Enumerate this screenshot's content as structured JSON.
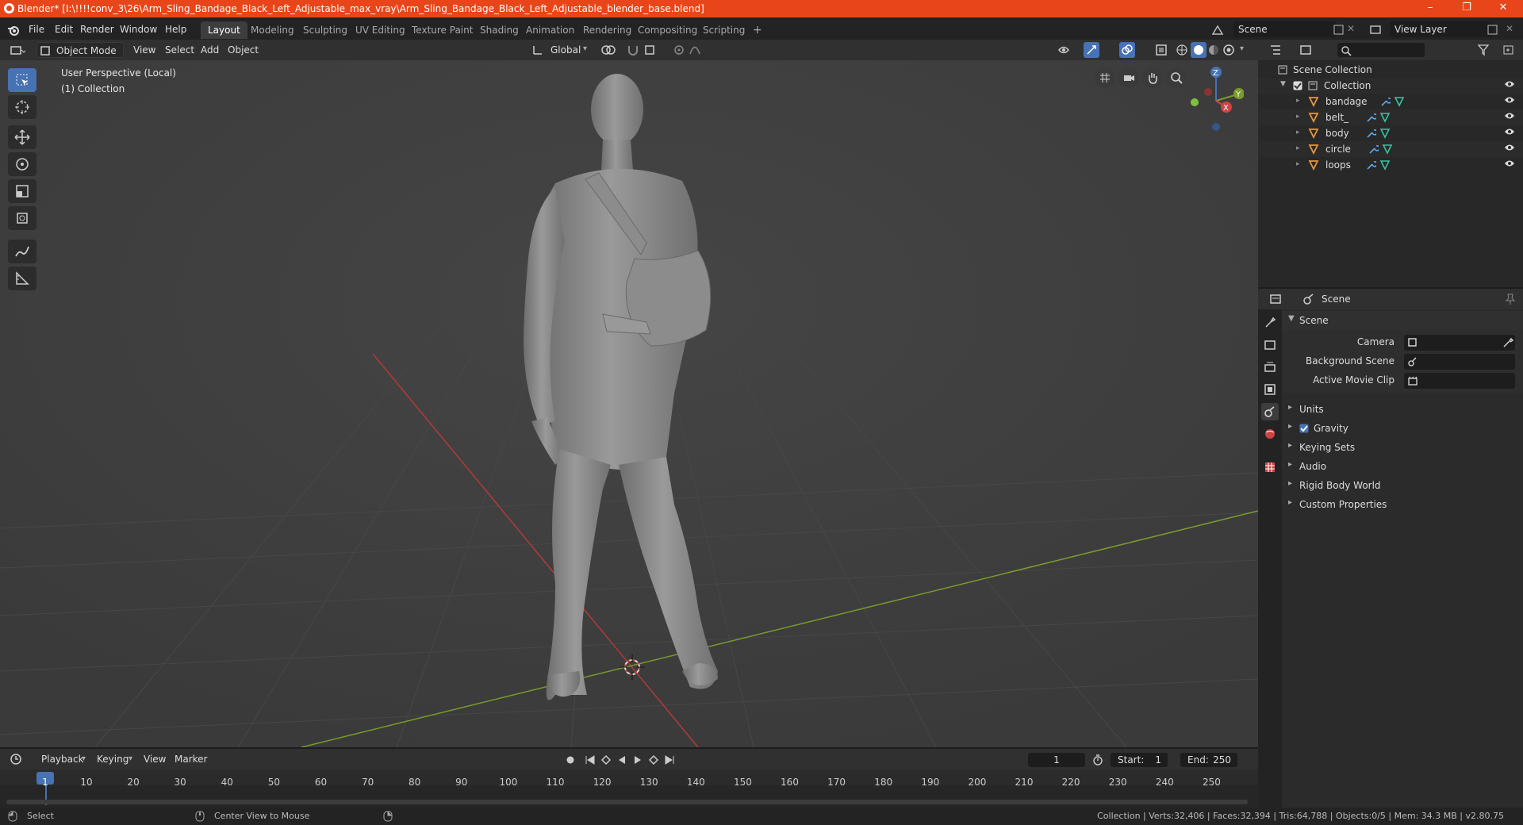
{
  "window": {
    "title": "Blender* [I:\\!!!!conv_3\\26\\Arm_Sling_Bandage_Black_Left_Adjustable_max_vray\\Arm_Sling_Bandage_Black_Left_Adjustable_blender_base.blend]",
    "minimize": "–",
    "maximize": "❐",
    "close": "✕"
  },
  "menu": [
    "File",
    "Edit",
    "Render",
    "Window",
    "Help"
  ],
  "workspaces": {
    "tabs": [
      "Layout",
      "Modeling",
      "Sculpting",
      "UV Editing",
      "Texture Paint",
      "Shading",
      "Animation",
      "Rendering",
      "Compositing",
      "Scripting"
    ],
    "active": "Layout",
    "add": "+"
  },
  "scene_selector": "Scene",
  "view_layer_selector": "View Layer",
  "viewport_header": {
    "mode": "Object Mode",
    "menus": [
      "View",
      "Select",
      "Add",
      "Object"
    ],
    "transform_orientation": "Global"
  },
  "viewport": {
    "perspective_label": "User Perspective (Local)",
    "collection_label": "(1) Collection",
    "gizmo": {
      "z": "Z",
      "y": "Y",
      "x": "X"
    },
    "colors": {
      "x_axis": "#b33a3a",
      "y_axis": "#7a9c2a",
      "grid": "#474747",
      "selection": "#4772b3"
    }
  },
  "outliner": {
    "root": "Scene Collection",
    "collection": "Collection",
    "objects": [
      "bandage",
      "belt_",
      "body",
      "circle",
      "loops"
    ]
  },
  "properties": {
    "context": "Scene",
    "panel_title": "Scene",
    "fields": [
      {
        "label": "Camera"
      },
      {
        "label": "Background Scene"
      },
      {
        "label": "Active Movie Clip"
      }
    ],
    "subpanels": [
      "Units",
      "Gravity",
      "Keying Sets",
      "Audio",
      "Rigid Body World",
      "Custom Properties"
    ],
    "gravity_enabled": true
  },
  "timeline": {
    "menus": [
      "Playback",
      "Keying",
      "View",
      "Marker"
    ],
    "current_frame": "1",
    "start_label": "Start:",
    "start": "1",
    "end_label": "End:",
    "end": "250",
    "ticks": [
      "1",
      "10",
      "20",
      "30",
      "40",
      "50",
      "60",
      "70",
      "80",
      "90",
      "100",
      "110",
      "120",
      "130",
      "140",
      "150",
      "160",
      "170",
      "180",
      "190",
      "200",
      "210",
      "220",
      "230",
      "240",
      "250"
    ]
  },
  "statusbar": {
    "left_action": "Select",
    "middle_action": "Center View to Mouse",
    "stats": "Collection | Verts:32,406 | Faces:32,394 | Tris:64,788 | Objects:0/5 | Mem: 34.3 MB | v2.80.75"
  }
}
